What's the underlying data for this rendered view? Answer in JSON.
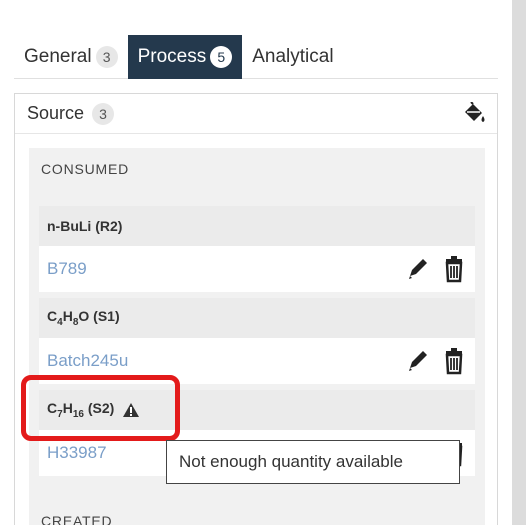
{
  "tabs": [
    {
      "label": "General",
      "count": "3",
      "active": false
    },
    {
      "label": "Process",
      "count": "5",
      "active": true
    },
    {
      "label": "Analytical",
      "count": "",
      "active": false
    }
  ],
  "source": {
    "label": "Source",
    "count": "3",
    "icon": "paint-bucket-icon"
  },
  "consumed": {
    "title": "CONSUMED",
    "items": [
      {
        "name_html": "n-BuLi (R2)",
        "batch": "B789",
        "warning": false
      },
      {
        "name_html": "C4H8O (S1)",
        "batch": "Batch245u",
        "warning": false
      },
      {
        "name_html": "C7H16 (S2)",
        "batch": "H33987",
        "warning": true
      }
    ]
  },
  "created": {
    "title": "CREATED"
  },
  "tooltip": {
    "text": "Not enough quantity available"
  },
  "colors": {
    "active_tab": "#24394d",
    "link": "#7a9ec8",
    "highlight": "#e31a1a"
  }
}
